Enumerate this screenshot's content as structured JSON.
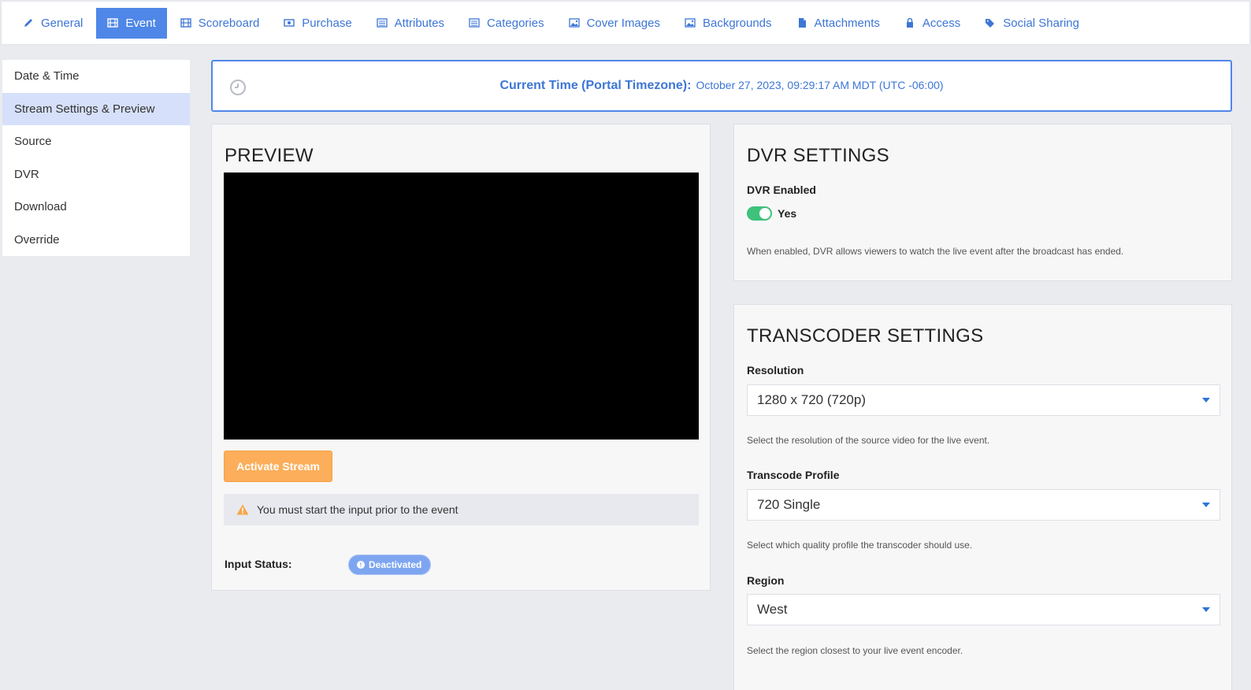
{
  "tabs": [
    {
      "label": "General",
      "icon": "pencil-icon"
    },
    {
      "label": "Event",
      "icon": "film-icon"
    },
    {
      "label": "Scoreboard",
      "icon": "film-icon"
    },
    {
      "label": "Purchase",
      "icon": "money-icon"
    },
    {
      "label": "Attributes",
      "icon": "list-icon"
    },
    {
      "label": "Categories",
      "icon": "list-icon"
    },
    {
      "label": "Cover Images",
      "icon": "image-icon"
    },
    {
      "label": "Backgrounds",
      "icon": "image-icon"
    },
    {
      "label": "Attachments",
      "icon": "file-icon"
    },
    {
      "label": "Access",
      "icon": "lock-icon"
    },
    {
      "label": "Social Sharing",
      "icon": "tags-icon"
    }
  ],
  "active_tab": "Event",
  "subnav": {
    "items": [
      {
        "label": "Date & Time"
      },
      {
        "label": "Stream Settings & Preview"
      },
      {
        "label": "Source"
      },
      {
        "label": "DVR"
      },
      {
        "label": "Download"
      },
      {
        "label": "Override"
      }
    ],
    "active": "Stream Settings & Preview"
  },
  "time_banner": {
    "label": "Current Time (Portal Timezone):",
    "value": "October 27, 2023, 09:29:17 AM MDT (UTC -06:00)"
  },
  "preview": {
    "title": "PREVIEW",
    "activate_label": "Activate Stream",
    "notice": "You must start the input prior to the event",
    "input_status_label": "Input Status:",
    "input_status_value": "Deactivated"
  },
  "dvr": {
    "title": "DVR SETTINGS",
    "enabled_label": "DVR Enabled",
    "toggle_value": "Yes",
    "help": "When enabled, DVR allows viewers to watch the live event after the broadcast has ended."
  },
  "transcoder": {
    "title": "TRANSCODER SETTINGS",
    "resolution_label": "Resolution",
    "resolution_value": "1280 x 720 (720p)",
    "resolution_help": "Select the resolution of the source video for the live event.",
    "profile_label": "Transcode Profile",
    "profile_value": "720 Single",
    "profile_help": "Select which quality profile the transcoder should use.",
    "region_label": "Region",
    "region_value": "West",
    "region_help": "Select the region closest to your live event encoder."
  },
  "colors": {
    "accent": "#4f87e8",
    "link": "#3d76d6",
    "activate": "#fcae5a",
    "toggle_on": "#3fc17c",
    "status_badge": "#7ea6f0"
  }
}
